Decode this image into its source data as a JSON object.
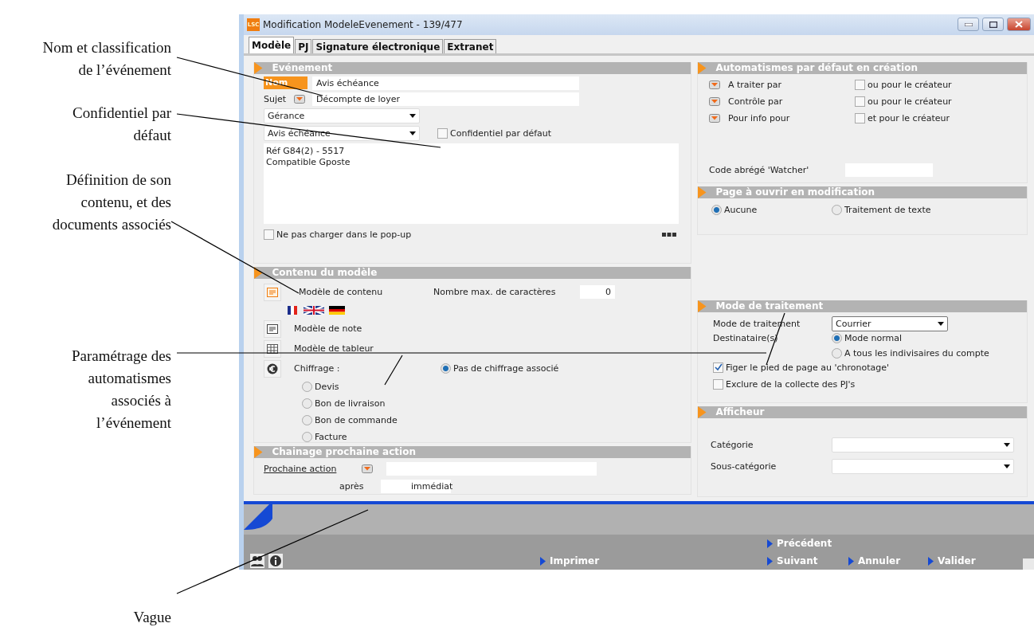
{
  "annotations": [
    {
      "lines": [
        "Nom et classification",
        "de l’événement"
      ]
    },
    {
      "lines": [
        "Confidentiel par",
        "défaut"
      ]
    },
    {
      "lines": [
        "Définition de son",
        "contenu, et des",
        "documents associés"
      ]
    },
    {
      "lines": [
        "Paramétrage des",
        "automatismes",
        "associés à",
        "l’événement"
      ]
    },
    {
      "lines": [
        "Vague"
      ]
    }
  ],
  "window": {
    "logo": "LSC",
    "title": "Modification ModeleEvenement - 139/477"
  },
  "tabs": [
    {
      "label": "Modèle",
      "selected": true
    },
    {
      "label": "PJ",
      "selected": false
    },
    {
      "label": "Signature électronique",
      "selected": false
    },
    {
      "label": "Extranet",
      "selected": false
    }
  ],
  "evenement": {
    "title": "Evénement",
    "nom_label": "Nom",
    "nom_value": "Avis échéance",
    "sujet_label": "Sujet",
    "sujet_value": "Décompte de loyer",
    "dropdown_1": "Gérance",
    "dropdown_2": "Avis échéance",
    "confidential": {
      "label": "Confidentiel par défaut",
      "checked": false
    },
    "notes": [
      "Réf G84(2) - 5517",
      "Compatible Gposte"
    ],
    "no_popup": {
      "label": "Ne pas charger dans le pop-up",
      "checked": false
    }
  },
  "contenu": {
    "title": "Contenu du modèle",
    "content_label": "Modèle de contenu",
    "max_chars_label": "Nombre max. de caractères",
    "max_chars_value": "0",
    "note_label": "Modèle de note",
    "tableur_label": "Modèle de tableur",
    "chiffrage_label": "Chiffrage :",
    "chiffrage_options": [
      {
        "label": "Pas de chiffrage associé",
        "selected": true
      },
      {
        "label": "Devis",
        "selected": false
      },
      {
        "label": "Bon de livraison",
        "selected": false
      },
      {
        "label": "Bon de commande",
        "selected": false
      },
      {
        "label": "Facture",
        "selected": false
      }
    ]
  },
  "chainage": {
    "title": "Chainage prochaine action",
    "action_label": "Prochaine action",
    "apres_label": "après",
    "apres_value": "immédiat"
  },
  "automatismes": {
    "title": "Automatismes par défaut en création",
    "rows": [
      {
        "label": "A traiter par",
        "option": "ou pour le créateur",
        "checked": false
      },
      {
        "label": "Contrôle par",
        "option": "ou pour le créateur",
        "checked": false
      },
      {
        "label": "Pour info pour",
        "option": "et pour le créateur",
        "checked": false
      }
    ],
    "watcher_label": "Code abrégé 'Watcher'"
  },
  "page_ouvrir": {
    "title": "Page à ouvrir en modification",
    "options": [
      {
        "label": "Aucune",
        "selected": true
      },
      {
        "label": "Traitement de texte",
        "selected": false
      }
    ]
  },
  "mode": {
    "title": "Mode de traitement",
    "mode_label": "Mode de traitement",
    "mode_value": "Courrier",
    "destinataires_label": "Destinataire(s)",
    "destinataire_options": [
      {
        "label": "Mode normal",
        "selected": true
      },
      {
        "label": "A tous les indivisaires du compte",
        "selected": false
      }
    ],
    "checkboxes": [
      {
        "label": "Figer le pied de page au 'chronotage'",
        "checked": true
      },
      {
        "label": "Exclure de la collecte des PJ's",
        "checked": false
      }
    ]
  },
  "afficheur": {
    "title": "Afficheur",
    "fields": [
      {
        "label": "Catégorie"
      },
      {
        "label": "Sous-catégorie"
      }
    ]
  },
  "footer": {
    "actions": [
      {
        "label": "Imprimer"
      },
      {
        "label": "Précédent"
      },
      {
        "label": "Suivant"
      },
      {
        "label": "Annuler"
      },
      {
        "label": "Valider"
      }
    ]
  }
}
